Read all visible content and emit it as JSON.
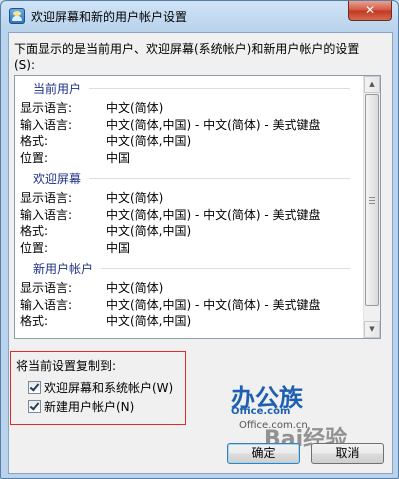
{
  "window": {
    "title": "欢迎屏幕和新的用户帐户设置",
    "close_label": "✕"
  },
  "description": "下面显示的是当前用户、欢迎屏幕(系统帐户)和新用户帐户的设置(S):",
  "sections": [
    {
      "header": "当前用户",
      "rows": [
        {
          "label": "显示语言:",
          "value": "中文(简体)"
        },
        {
          "label": "输入语言:",
          "value": "中文(简体,中国) - 中文(简体) - 美式键盘"
        },
        {
          "label": "格式:",
          "value": "中文(简体,中国)"
        },
        {
          "label": "位置:",
          "value": "中国"
        }
      ]
    },
    {
      "header": "欢迎屏幕",
      "rows": [
        {
          "label": "显示语言:",
          "value": "中文(简体)"
        },
        {
          "label": "输入语言:",
          "value": "中文(简体,中国) - 中文(简体) - 美式键盘"
        },
        {
          "label": "格式:",
          "value": "中文(简体,中国)"
        },
        {
          "label": "位置:",
          "value": "中国"
        }
      ]
    },
    {
      "header": "新用户帐户",
      "rows": [
        {
          "label": "显示语言:",
          "value": "中文(简体)"
        },
        {
          "label": "输入语言:",
          "value": "中文(简体,中国) - 中文(简体) - 美式键盘"
        },
        {
          "label": "格式:",
          "value": "中文(简体,中国)"
        }
      ]
    }
  ],
  "copy": {
    "label": "将当前设置复制到:",
    "options": [
      {
        "label": "欢迎屏幕和系统帐户(W)",
        "checked": true
      },
      {
        "label": "新建用户帐户(N)",
        "checked": true
      }
    ]
  },
  "buttons": {
    "ok": "确定",
    "cancel": "取消"
  },
  "watermark": {
    "brand": "办公族",
    "site": "Office.com",
    "site2": "Office.com.cn",
    "baidu": "Bai经验"
  },
  "scrollbar": {
    "up": "▲",
    "down": "▼"
  },
  "colors": {
    "section_header": "#1e3287",
    "highlight_box": "#e32b2b"
  }
}
